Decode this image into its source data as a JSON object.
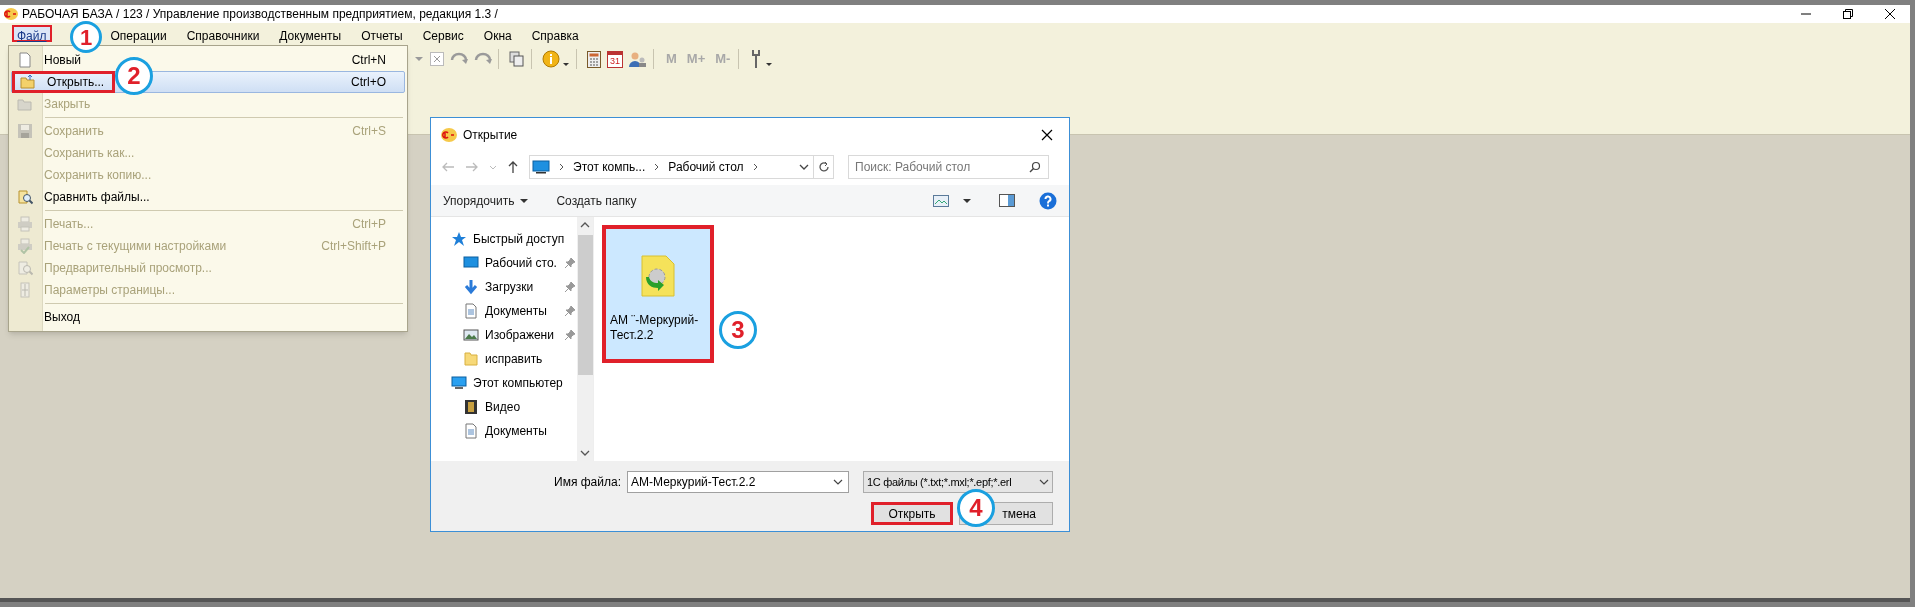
{
  "window": {
    "title": "РАБОЧАЯ БАЗА / 123 /  Управление производственным предприятием, редакция 1.3 /"
  },
  "menu_bar": [
    {
      "label": "Файл",
      "selected": true,
      "highlighted": true
    },
    {
      "label": "Операции",
      "selected": false,
      "highlighted": false
    },
    {
      "label": "Справочники",
      "selected": false,
      "highlighted": false
    },
    {
      "label": "Документы",
      "selected": false,
      "highlighted": false
    },
    {
      "label": "Отчеты",
      "selected": false,
      "highlighted": false
    },
    {
      "label": "Сервис",
      "selected": false,
      "highlighted": false
    },
    {
      "label": "Окна",
      "selected": false,
      "highlighted": false
    },
    {
      "label": "Справка",
      "selected": false,
      "highlighted": false
    }
  ],
  "toolbar": [
    {
      "kind": "dropdown"
    },
    {
      "kind": "cross"
    },
    {
      "kind": "swirl"
    },
    {
      "kind": "swirl"
    },
    {
      "kind": "separator"
    },
    {
      "kind": "copy"
    },
    {
      "kind": "separator"
    },
    {
      "kind": "info"
    },
    {
      "kind": "separator"
    },
    {
      "kind": "calculator"
    },
    {
      "kind": "calendar",
      "label": "31"
    },
    {
      "kind": "users"
    },
    {
      "kind": "separator"
    },
    {
      "kind": "text",
      "label": "M"
    },
    {
      "kind": "text",
      "label": "M+"
    },
    {
      "kind": "text",
      "label": "M-"
    },
    {
      "kind": "separator"
    },
    {
      "kind": "tools"
    }
  ],
  "file_menu": [
    {
      "kind": "item",
      "label": "Новый",
      "shortcut": "Ctrl+N",
      "disabled": false,
      "selected": false,
      "highlighted": false
    },
    {
      "kind": "item",
      "label": "Открыть...",
      "shortcut": "Ctrl+O",
      "disabled": false,
      "selected": true,
      "highlighted": true
    },
    {
      "kind": "item",
      "label": "Закрыть",
      "disabled": true,
      "selected": false,
      "highlighted": false
    },
    {
      "kind": "separator"
    },
    {
      "kind": "item",
      "label": "Сохранить",
      "shortcut": "Ctrl+S",
      "disabled": true,
      "selected": false,
      "highlighted": false
    },
    {
      "kind": "item",
      "label": "Сохранить как...",
      "disabled": true,
      "selected": false,
      "highlighted": false
    },
    {
      "kind": "item",
      "label": "Сохранить копию...",
      "disabled": true,
      "selected": false,
      "highlighted": false
    },
    {
      "kind": "item",
      "label": "Сравнить файлы...",
      "disabled": false,
      "selected": false,
      "highlighted": false
    },
    {
      "kind": "separator"
    },
    {
      "kind": "item",
      "label": "Печать...",
      "shortcut": "Ctrl+P",
      "disabled": true,
      "selected": false,
      "highlighted": false
    },
    {
      "kind": "item",
      "label": "Печать с текущими настройками",
      "shortcut": "Ctrl+Shift+P",
      "disabled": true,
      "selected": false,
      "highlighted": false
    },
    {
      "kind": "item",
      "label": "Предварительный просмотр...",
      "disabled": true,
      "selected": false,
      "highlighted": false
    },
    {
      "kind": "item",
      "label": "Параметры страницы...",
      "disabled": true,
      "selected": false,
      "highlighted": false
    },
    {
      "kind": "separator"
    },
    {
      "kind": "item",
      "label": "Выход",
      "disabled": false,
      "selected": false,
      "highlighted": false
    }
  ],
  "dialog": {
    "title": "Открытие",
    "address": [
      "Этот компь...",
      "Рабочий стол"
    ],
    "search": {
      "placeholder": "Поиск: Рабочий стол"
    },
    "commands": [
      "Упорядочить",
      "Создать папку"
    ],
    "nav": [
      {
        "label": "Быстрый доступ",
        "children": [
          {
            "label": "Рабочий сто.",
            "pinned": true
          },
          {
            "label": "Загрузки",
            "pinned": true
          },
          {
            "label": "Документы",
            "pinned": true
          },
          {
            "label": "Изображени",
            "pinned": true
          },
          {
            "label": "исправить",
            "pinned": false
          }
        ]
      },
      {
        "label": "Этот компьютер",
        "children": [
          {
            "label": "Видео",
            "pinned": false
          },
          {
            "label": "Документы",
            "pinned": false
          }
        ]
      }
    ],
    "files": [
      {
        "name": "АМ ¨-Меркурий-Тест.2.2",
        "selected": true,
        "highlighted": true
      }
    ],
    "filename_label": "Имя файла:",
    "filename": "АМ-Меркурий-Тест.2.2",
    "filter": "1С файлы (*.txt;*.mxl;*.epf;*.erl",
    "buttons": [
      {
        "label": "Открыть",
        "highlighted": true
      },
      {
        "label": "тмена",
        "highlighted": false
      }
    ]
  },
  "annotations": [
    {
      "number": "1"
    },
    {
      "number": "2"
    },
    {
      "number": "3"
    },
    {
      "number": "4"
    }
  ]
}
